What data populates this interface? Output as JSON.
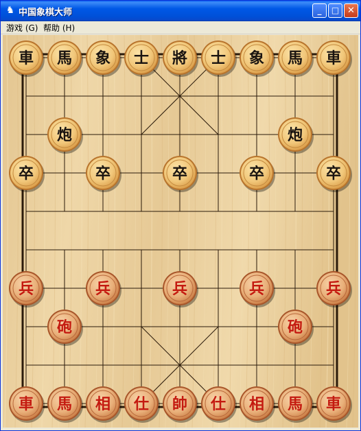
{
  "window": {
    "title": "中国象棋大师",
    "app_icon": "chess-app-icon",
    "minimize_label": "_",
    "maximize_label": "□",
    "close_label": "✕"
  },
  "menu": {
    "items": [
      {
        "label": "游戏 (G)"
      },
      {
        "label": "帮助 (H)"
      }
    ]
  },
  "board": {
    "files": 9,
    "ranks": 10,
    "wood_color": "#e8cd98",
    "line_color": "#2a1a0a",
    "black_piece_text_color": "#1a1410",
    "red_piece_text_color": "#c41a10",
    "black_piece_face": "#f1c77a",
    "red_piece_face": "#e9b07a",
    "pieces": [
      {
        "side": "black",
        "label": "車",
        "file": 0,
        "rank": 0
      },
      {
        "side": "black",
        "label": "馬",
        "file": 1,
        "rank": 0
      },
      {
        "side": "black",
        "label": "象",
        "file": 2,
        "rank": 0
      },
      {
        "side": "black",
        "label": "士",
        "file": 3,
        "rank": 0
      },
      {
        "side": "black",
        "label": "將",
        "file": 4,
        "rank": 0
      },
      {
        "side": "black",
        "label": "士",
        "file": 5,
        "rank": 0
      },
      {
        "side": "black",
        "label": "象",
        "file": 6,
        "rank": 0
      },
      {
        "side": "black",
        "label": "馬",
        "file": 7,
        "rank": 0
      },
      {
        "side": "black",
        "label": "車",
        "file": 8,
        "rank": 0
      },
      {
        "side": "black",
        "label": "炮",
        "file": 1,
        "rank": 2
      },
      {
        "side": "black",
        "label": "炮",
        "file": 7,
        "rank": 2
      },
      {
        "side": "black",
        "label": "卒",
        "file": 0,
        "rank": 3
      },
      {
        "side": "black",
        "label": "卒",
        "file": 2,
        "rank": 3
      },
      {
        "side": "black",
        "label": "卒",
        "file": 4,
        "rank": 3
      },
      {
        "side": "black",
        "label": "卒",
        "file": 6,
        "rank": 3
      },
      {
        "side": "black",
        "label": "卒",
        "file": 8,
        "rank": 3
      },
      {
        "side": "red",
        "label": "兵",
        "file": 0,
        "rank": 6
      },
      {
        "side": "red",
        "label": "兵",
        "file": 2,
        "rank": 6
      },
      {
        "side": "red",
        "label": "兵",
        "file": 4,
        "rank": 6
      },
      {
        "side": "red",
        "label": "兵",
        "file": 6,
        "rank": 6
      },
      {
        "side": "red",
        "label": "兵",
        "file": 8,
        "rank": 6
      },
      {
        "side": "red",
        "label": "砲",
        "file": 1,
        "rank": 7
      },
      {
        "side": "red",
        "label": "砲",
        "file": 7,
        "rank": 7
      },
      {
        "side": "red",
        "label": "車",
        "file": 0,
        "rank": 9
      },
      {
        "side": "red",
        "label": "馬",
        "file": 1,
        "rank": 9
      },
      {
        "side": "red",
        "label": "相",
        "file": 2,
        "rank": 9
      },
      {
        "side": "red",
        "label": "仕",
        "file": 3,
        "rank": 9
      },
      {
        "side": "red",
        "label": "帥",
        "file": 4,
        "rank": 9
      },
      {
        "side": "red",
        "label": "仕",
        "file": 5,
        "rank": 9
      },
      {
        "side": "red",
        "label": "相",
        "file": 6,
        "rank": 9
      },
      {
        "side": "red",
        "label": "馬",
        "file": 7,
        "rank": 9
      },
      {
        "side": "red",
        "label": "車",
        "file": 8,
        "rank": 9
      }
    ]
  }
}
